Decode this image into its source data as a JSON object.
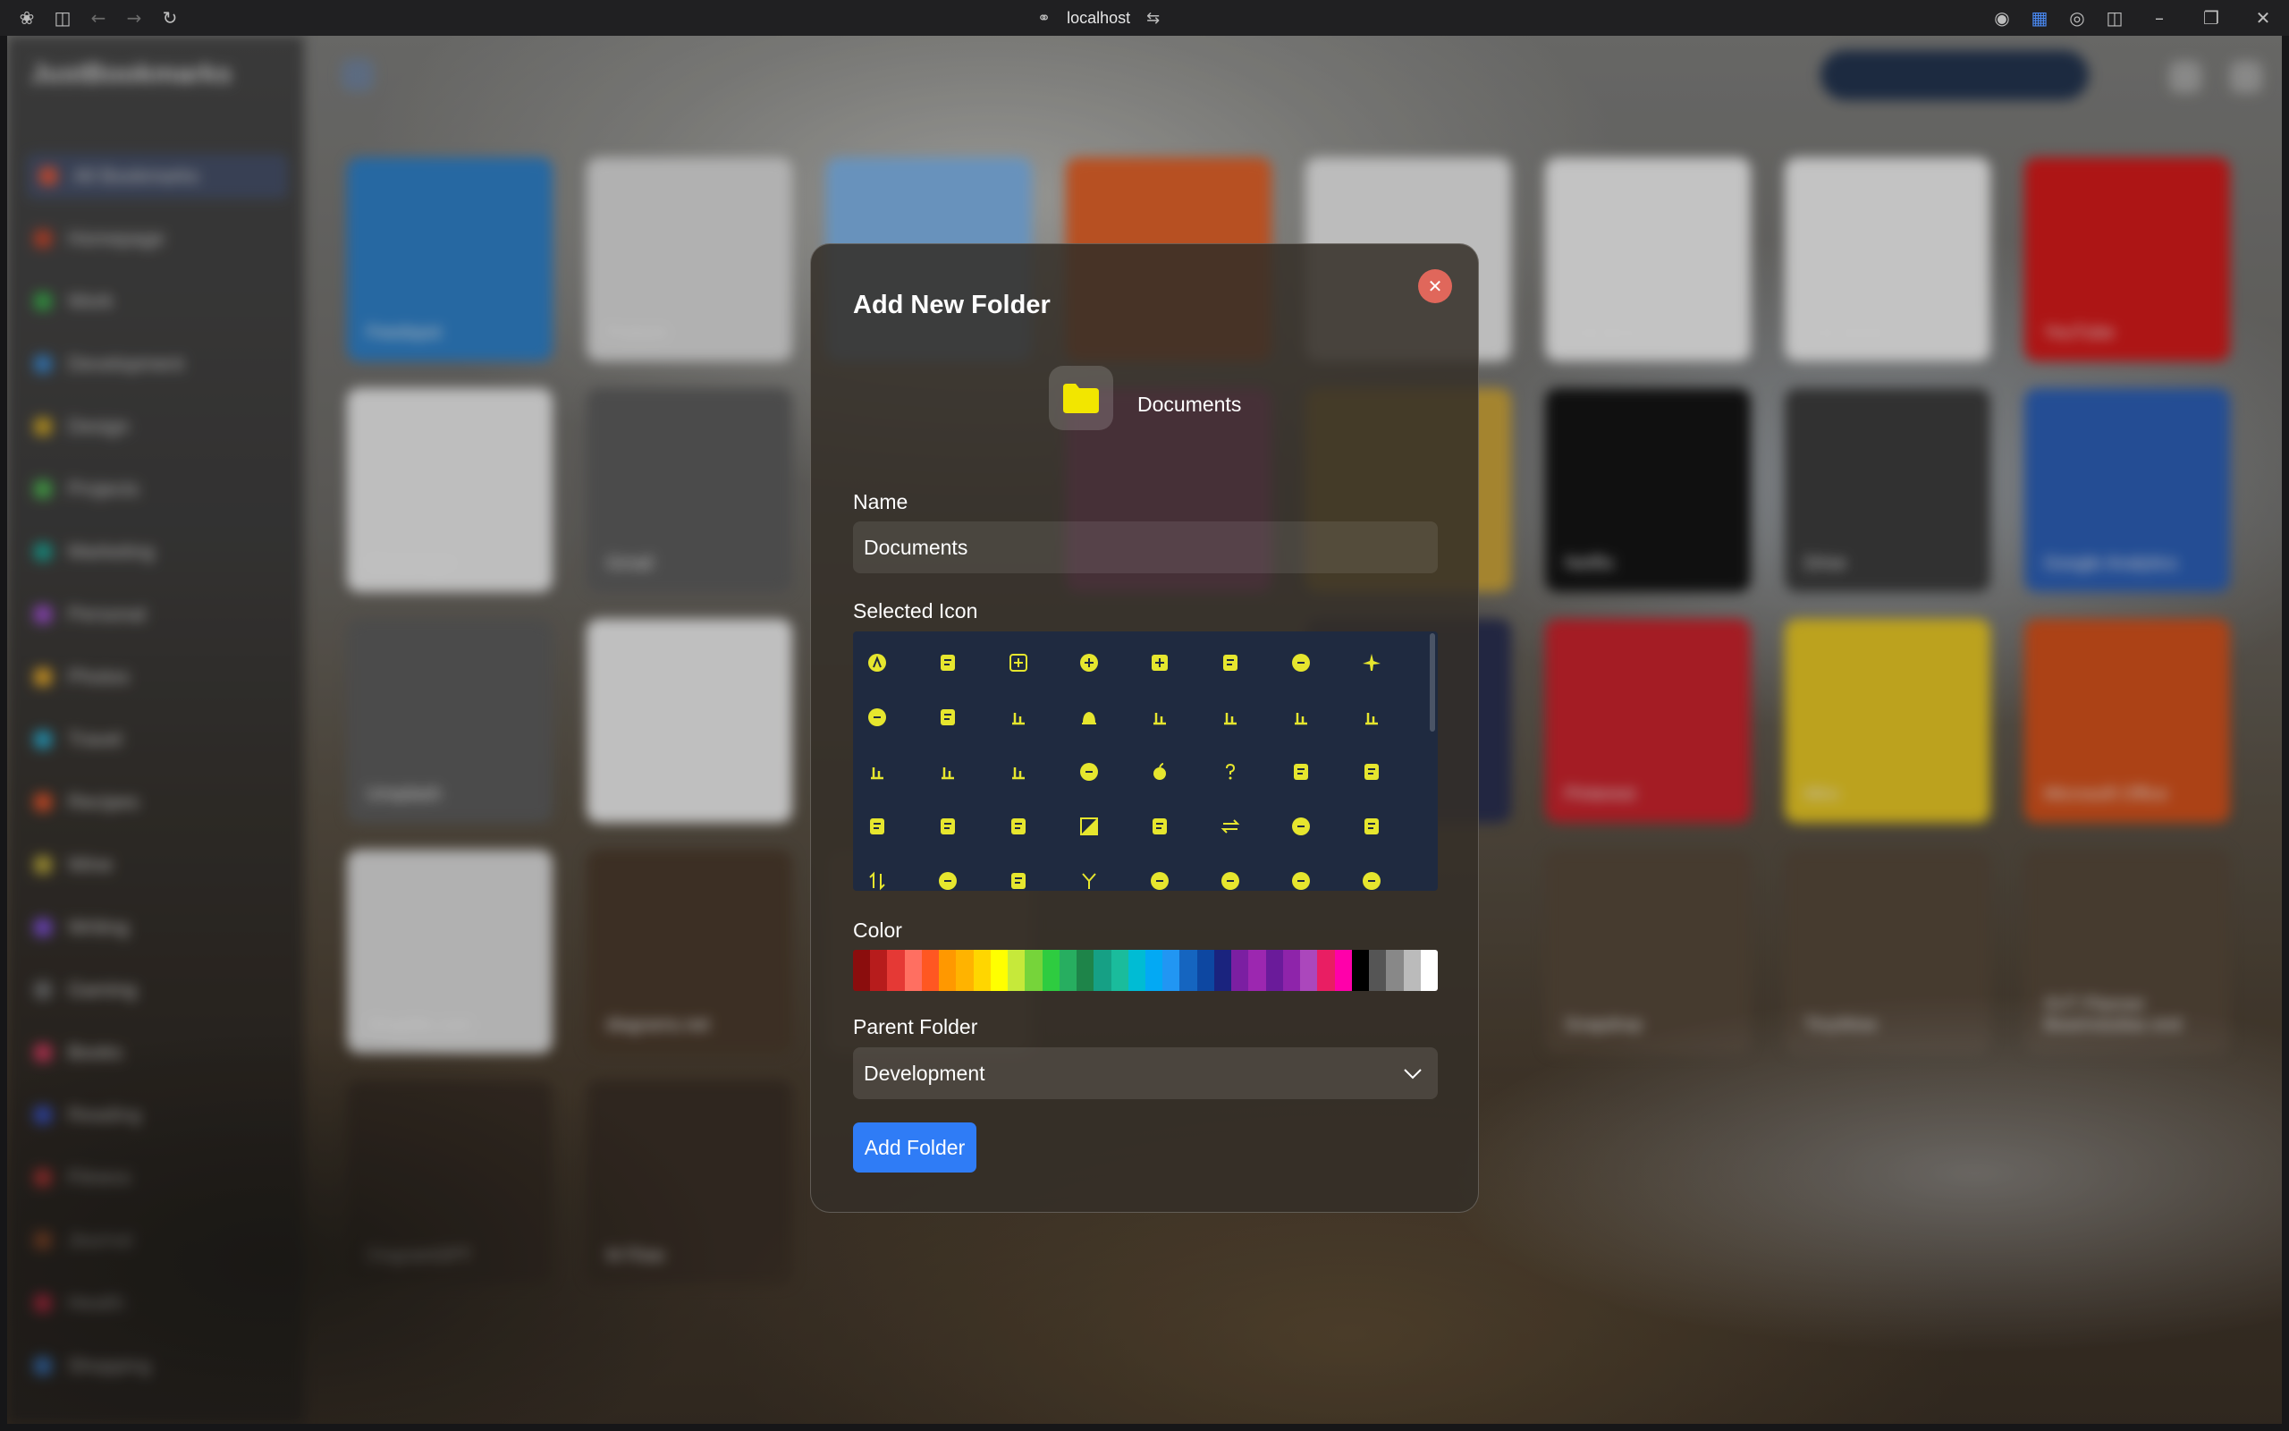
{
  "browser": {
    "url": "localhost"
  },
  "background_app": {
    "brand": "JustBookmarks",
    "sidebar_items": [
      {
        "label": "All Bookmarks",
        "color": "#e0573a"
      },
      {
        "label": "Homepage",
        "color": "#c0462d"
      },
      {
        "label": "Work",
        "color": "#3aa64a"
      },
      {
        "label": "Development",
        "color": "#3b82c4"
      },
      {
        "label": "Design",
        "color": "#c9a227"
      },
      {
        "label": "Projects",
        "color": "#4caf50"
      },
      {
        "label": "Marketing",
        "color": "#1e9e8f"
      },
      {
        "label": "Personal",
        "color": "#9b4fc9"
      },
      {
        "label": "Photos",
        "color": "#e0a62b"
      },
      {
        "label": "Travel",
        "color": "#2ba3c4"
      },
      {
        "label": "Recipes",
        "color": "#d9532b"
      },
      {
        "label": "Wine",
        "color": "#b3a23a"
      },
      {
        "label": "Writing",
        "color": "#7b4fd0"
      },
      {
        "label": "Gaming",
        "color": "#6a6a6a"
      },
      {
        "label": "Books",
        "color": "#c43a5a"
      },
      {
        "label": "Reading",
        "color": "#3a54c9"
      },
      {
        "label": "Fitness",
        "color": "#c93a3a"
      },
      {
        "label": "Journal",
        "color": "#a0522d"
      },
      {
        "label": "Health",
        "color": "#d62c4a"
      },
      {
        "label": "Shopping",
        "color": "#3a7bc9"
      }
    ],
    "tiles": [
      {
        "label": "Feedspot",
        "bg": "#2f7fc6"
      },
      {
        "label": "Posture",
        "bg": "#d8d8d8"
      },
      {
        "label": "",
        "bg": "#7fb3e6"
      },
      {
        "label": "",
        "bg": "#e0622a"
      },
      {
        "label": "",
        "bg": "#e6e6e6"
      },
      {
        "label": "Calendar",
        "bg": "#eeeeee"
      },
      {
        "label": "Facebook",
        "bg": "#eeeeee"
      },
      {
        "label": "YouTube",
        "bg": "#d41a1a"
      },
      {
        "label": "Messenger",
        "bg": "#e8e8e8"
      },
      {
        "label": "Gmail",
        "bg": "#5c5c5c"
      },
      {
        "label": "",
        "bg": "#d84cb7"
      },
      {
        "label": "",
        "bg": "#c9a23a"
      },
      {
        "label": "Netflix",
        "bg": "#141414"
      },
      {
        "label": "Drive",
        "bg": "#3c3c3c"
      },
      {
        "label": "Google Analytics",
        "bg": "#2c5fb5"
      },
      {
        "label": "Unsplash",
        "bg": "#5c5c5c"
      },
      {
        "label": "",
        "bg": "#eaeaea"
      },
      {
        "label": "",
        "bg": "#2a2f50"
      },
      {
        "label": "Pinterest",
        "bg": "#c8232c"
      },
      {
        "label": "Miro",
        "bg": "#e6c625"
      },
      {
        "label": "Microsoft Office",
        "bg": "#d2511c"
      },
      {
        "label": "ShopMe.com",
        "bg": "#d8d8d8"
      },
      {
        "label": "diagrams.net",
        "bg": "#4a3a2c"
      },
      {
        "label": "",
        "bg": "#6a5a48"
      },
      {
        "label": "Snapdrop",
        "bg": "#56483a"
      },
      {
        "label": "TinyWow",
        "bg": "#56483a"
      },
      {
        "label": "SVT Planner Bearinstulias ond",
        "bg": "#56483a"
      },
      {
        "label": "DiagramGPT",
        "bg": "#3a2f26"
      },
      {
        "label": "M Flow",
        "bg": "#3a2f26"
      }
    ]
  },
  "modal": {
    "title": "Add New Folder",
    "close_icon": "close-x",
    "preview": {
      "icon": "folder-icon",
      "icon_color": "#f2e600",
      "name": "Documents"
    },
    "name_label": "Name",
    "name_value": "Documents",
    "icon_label": "Selected Icon",
    "icon_color": "#e6e62e",
    "icons": [
      "a-circle-icon",
      "activity-icon",
      "plus-square-icon",
      "plus-circle-icon",
      "plus-box-icon",
      "copy-plus-icon",
      "alarm-icon",
      "plane-icon",
      "airplane-circle-icon",
      "box-icon",
      "tool-icon",
      "bell-icon",
      "align-bottom-icon",
      "align-center-icon",
      "align-left-icon",
      "align-right-icon",
      "align-top-icon",
      "align-middle-icon",
      "android-icon",
      "aperture-icon",
      "apple-icon",
      "help-icon",
      "bookmark-square-icon",
      "bookmark-flag-icon",
      "clipboard-icon",
      "archive-icon",
      "bookmark-icon",
      "triangle-half-icon",
      "bookmark-check-icon",
      "arrows-swap-icon",
      "arrows-circle-icon",
      "swap-box-icon",
      "arrows-updown-icon",
      "arrows-updown-circle-icon",
      "arrows-updown-box-icon",
      "branch-icon",
      "chevron-down-circle-icon",
      "arrow-down-circle-icon",
      "chevron-left-circle-icon",
      "arrow-left-circle-icon"
    ],
    "color_label": "Color",
    "colors": [
      "#8b0d0d",
      "#b71c1c",
      "#e53935",
      "#ff6f61",
      "#ff5722",
      "#ff9800",
      "#ffb300",
      "#ffd600",
      "#ffff00",
      "#c6e93a",
      "#76d43a",
      "#2ecc40",
      "#27ae60",
      "#1e8449",
      "#16a085",
      "#1abc9c",
      "#00bcd4",
      "#03a9f4",
      "#2196f3",
      "#1565c0",
      "#0d47a1",
      "#1a237e",
      "#7b1fa2",
      "#9c27b0",
      "#6a1b9a",
      "#8e24aa",
      "#ab47bc",
      "#e91e63",
      "#ff00aa",
      "#000000",
      "#555555",
      "#888888",
      "#bbbbbb",
      "#ffffff"
    ],
    "parent_label": "Parent Folder",
    "parent_value": "Development",
    "submit_label": "Add Folder",
    "accent": "#2f7cf6"
  }
}
